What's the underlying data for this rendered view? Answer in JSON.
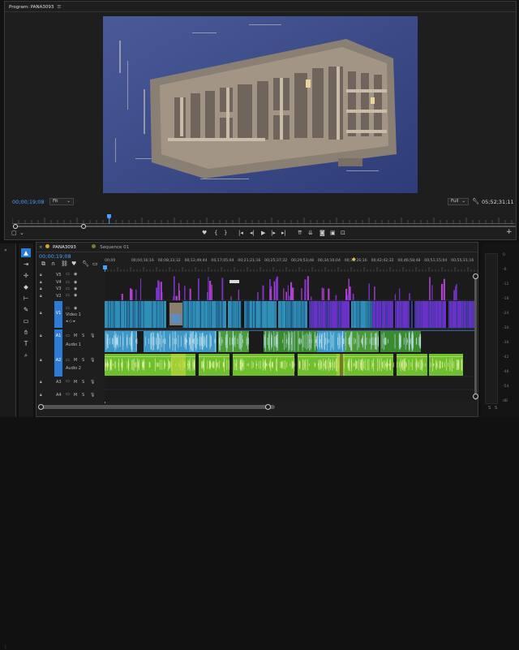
{
  "monitor": {
    "title": "Program: PANA3093",
    "menu_icon": "menu-icon",
    "timecode_current": "00;00;19;08",
    "fit": "Fit",
    "resolution": "Full",
    "timecode_duration": "05;52;31;11"
  },
  "timeline": {
    "tabs": [
      {
        "label": "PANA3093"
      },
      {
        "label": "Sequence 01"
      }
    ],
    "current_timecode": "00;00;19;08",
    "ruler": [
      "00;00",
      "00;04;16;16",
      "00;08;33;32",
      "00;12;49;44",
      "00;17;05;04",
      "00;21;21;16",
      "00;25;37;32",
      "00;29;53;48",
      "00;34;10;04",
      "00;38;26;16",
      "00;42;42;32",
      "00;46;58;48",
      "00;51;15;04",
      "00;55;31;16"
    ],
    "video_tracks": [
      {
        "id": "V5"
      },
      {
        "id": "V4"
      },
      {
        "id": "V3"
      },
      {
        "id": "V2"
      },
      {
        "id": "V1",
        "name": "Video 1",
        "target": "V1"
      }
    ],
    "audio_tracks": [
      {
        "id": "A1",
        "name": "Audio 1",
        "target": "A1"
      },
      {
        "id": "A2",
        "name": "Audio 2",
        "target": "A2"
      },
      {
        "id": "A3"
      },
      {
        "id": "A4"
      }
    ],
    "toggle_labels": {
      "mute": "M",
      "solo": "S"
    }
  },
  "meters": {
    "scale": [
      "0",
      "-6",
      "-12",
      "-18",
      "-24",
      "-30",
      "-36",
      "-42",
      "-48",
      "-54",
      "dB"
    ],
    "bottom_labels": [
      "S",
      "S"
    ]
  },
  "colors": {
    "accent": "#2d7bd4",
    "video_clip": "#2f8fb6",
    "video_clip_alt": "#6a30c8",
    "audio1": "#3e98c6",
    "audio2": "#6fbf2e"
  }
}
